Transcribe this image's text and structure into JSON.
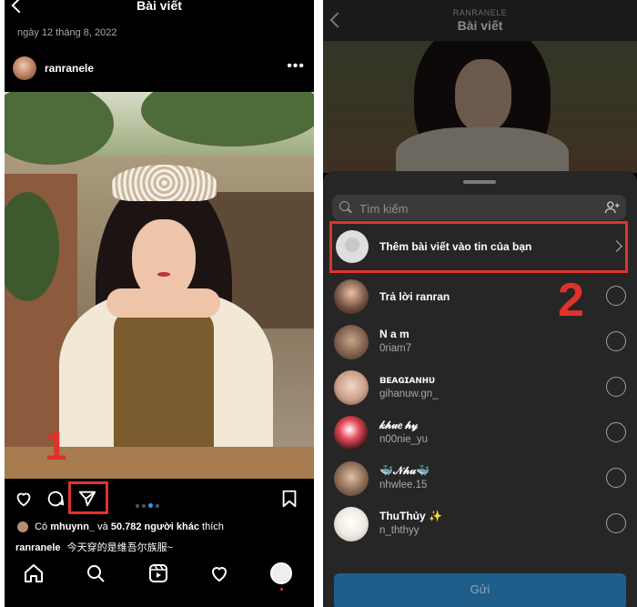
{
  "left": {
    "header_title": "Bài viết",
    "date": "ngày 12 tháng 8, 2022",
    "post_user": "ranranele",
    "more_label": "•••",
    "likes": {
      "prefix": "Có",
      "user": "mhuynn_",
      "middle": "và",
      "count": "50.782 người khác",
      "suffix": "thích"
    },
    "caption": {
      "user": "ranranele",
      "text": "今天穿的是维吾尔族服~"
    },
    "step_label": "1",
    "tabs": [
      "home-icon",
      "search-icon",
      "reels-icon",
      "heart-icon",
      "profile-icon"
    ]
  },
  "right": {
    "header_sup": "RANRANELE",
    "header_title": "Bài viết",
    "search_placeholder": "Tìm kiếm",
    "story_label": "Thêm bài viết vào tin của bạn",
    "step_label": "2",
    "contacts": [
      {
        "name": "Trả lời ranran",
        "handle": ""
      },
      {
        "name": "N a m",
        "handle": "0riam7"
      },
      {
        "name": "ʙᴇᴀɢɪᴀɴʜᴜ",
        "handle": "gihanuw.gn_"
      },
      {
        "name": "𝓀𝒽𝓊𝑒 𝒽𝓎",
        "handle": "n00nie_yu"
      },
      {
        "name": "🐳𝒩𝒽𝓊🐳",
        "handle": "nhwlee.15"
      },
      {
        "name": "ThuThủy ✨",
        "handle": "n_ththyy"
      }
    ],
    "send_label": "Gửi"
  },
  "colors": {
    "highlight": "#e0322a",
    "accent": "#3897f0",
    "sheet": "#262626"
  }
}
